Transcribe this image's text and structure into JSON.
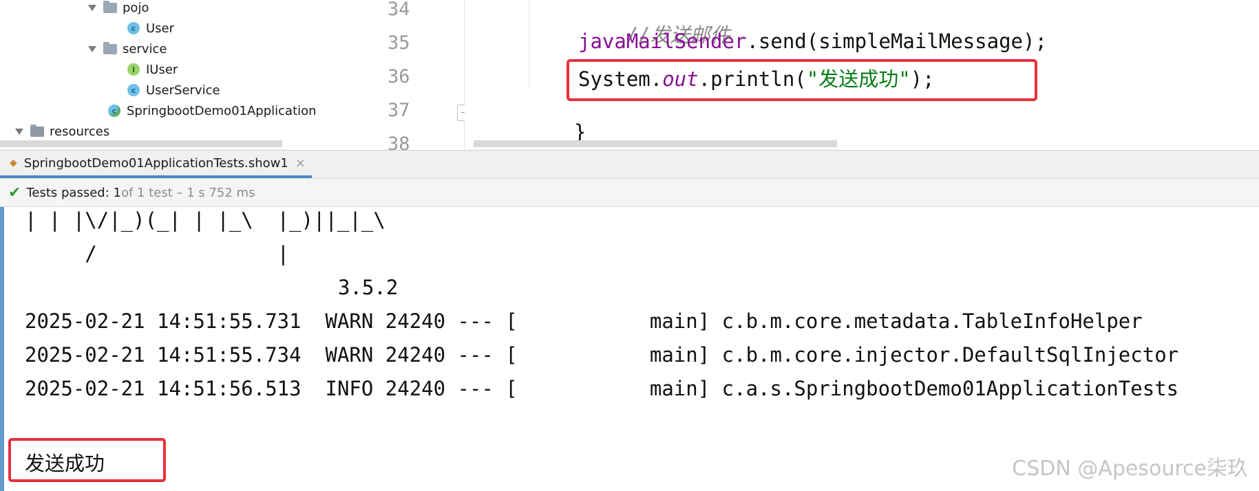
{
  "project_tree": {
    "items": [
      {
        "label": "pojo",
        "type": "folder"
      },
      {
        "label": "User",
        "type": "class"
      },
      {
        "label": "service",
        "type": "folder"
      },
      {
        "label": "IUser",
        "type": "interface"
      },
      {
        "label": "UserService",
        "type": "class"
      },
      {
        "label": "SpringbootDemo01Application",
        "type": "application-class"
      },
      {
        "label": "resources",
        "type": "resources-folder"
      }
    ]
  },
  "editor": {
    "line_numbers": [
      "34",
      "35",
      "36",
      "37",
      "38"
    ],
    "lines": {
      "comment": "//发送邮件",
      "l35_field": "javaMailSender",
      "l35_rest": ".send(simpleMailMessage);",
      "l36_prefix": "System.",
      "l36_static": "out",
      "l36_mid": ".println(",
      "l36_string": "\"发送成功\"",
      "l36_end": ");",
      "l37": "}"
    }
  },
  "run_panel": {
    "tab_label": "SpringbootDemo01ApplicationTests.show1",
    "tab_close": "×",
    "status_prefix": "Tests passed: 1",
    "status_suffix": " of 1 test – 1 s 752 ms"
  },
  "console": {
    "banner_line1": "| | |\\/|_)(_| | |_\\  |_)||_|_\\",
    "banner_line2": "     /               |",
    "version": "3.5.2",
    "logs": [
      "2025-02-21 14:51:55.731  WARN 24240 --- [           main] c.b.m.core.metadata.TableInfoHelper",
      "2025-02-21 14:51:55.734  WARN 24240 --- [           main] c.b.m.core.injector.DefaultSqlInjector",
      "2025-02-21 14:51:56.513  INFO 24240 --- [           main] c.a.s.SpringbootDemo01ApplicationTests"
    ],
    "output": "发送成功"
  },
  "watermark": "CSDN @Apesource柒玖",
  "colors": {
    "accent": "#4a88c7",
    "highlight_box": "#e8303c",
    "success": "#3a9b3e"
  }
}
